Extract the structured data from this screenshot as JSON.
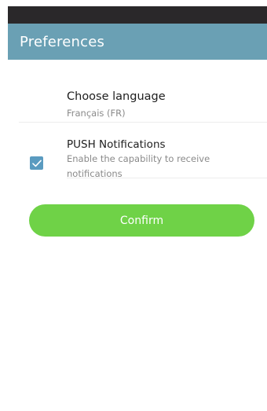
{
  "app_bar": {
    "title": "Preferences"
  },
  "language": {
    "title": "Choose language",
    "value": "Français (FR)"
  },
  "push": {
    "title": "PUSH Notifications",
    "description": "Enable the capability to receive notifications",
    "checked": true,
    "check_icon": "check-icon"
  },
  "confirm": {
    "label": "Confirm"
  },
  "colors": {
    "app_bar": "#6aa0b4",
    "status_bar": "#2a282a",
    "accent_checkbox": "#5a9bc0",
    "confirm_button": "#6fd247"
  }
}
